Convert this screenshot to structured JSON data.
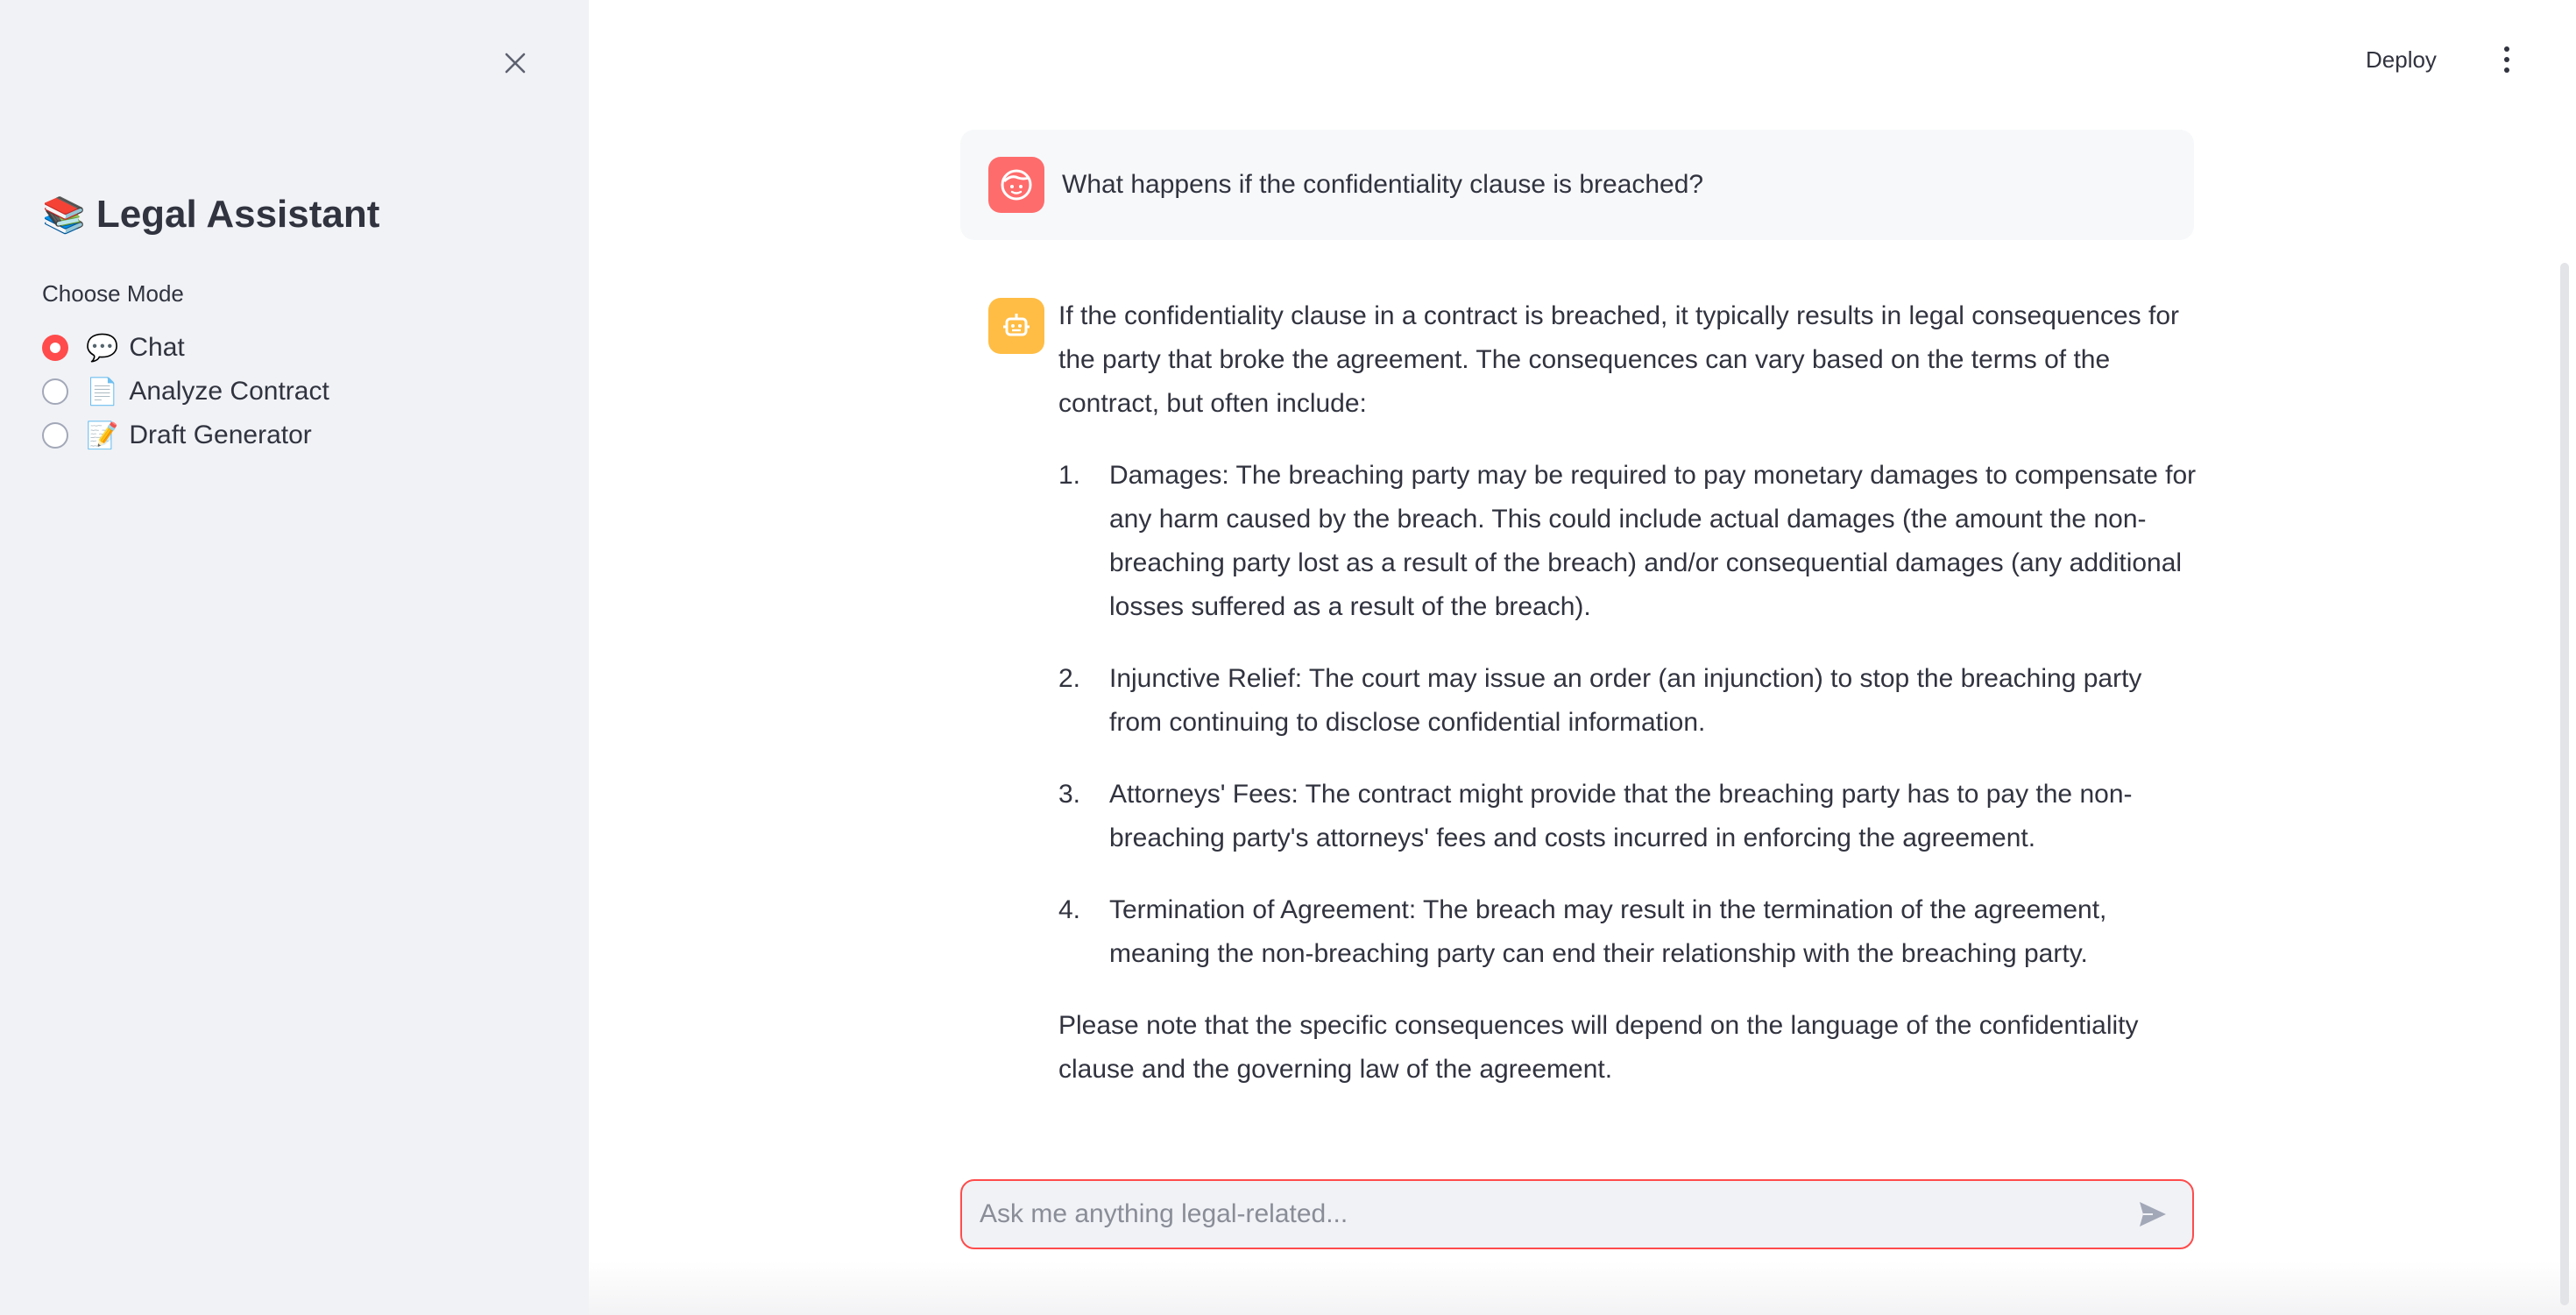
{
  "sidebar": {
    "title_emoji": "📚",
    "title": "Legal Assistant",
    "mode_label": "Choose Mode",
    "modes": [
      {
        "emoji": "💬",
        "label": "Chat",
        "selected": true
      },
      {
        "emoji": "📄",
        "label": "Analyze Contract",
        "selected": false
      },
      {
        "emoji": "📝",
        "label": "Draft Generator",
        "selected": false
      }
    ]
  },
  "header": {
    "deploy_label": "Deploy"
  },
  "chat": {
    "user_message": "What happens if the confidentiality clause is breached?",
    "bot_intro": "If the confidentiality clause in a contract is breached, it typically results in legal consequences for the party that broke the agreement. The consequences can vary based on the terms of the contract, but often include:",
    "bot_items": [
      {
        "num": "1.",
        "text": "Damages: The breaching party may be required to pay monetary damages to compensate for any harm caused by the breach. This could include actual damages (the amount the non-breaching party lost as a result of the breach) and/or consequential damages (any additional losses suffered as a result of the breach)."
      },
      {
        "num": "2.",
        "text": "Injunctive Relief: The court may issue an order (an injunction) to stop the breaching party from continuing to disclose confidential information."
      },
      {
        "num": "3.",
        "text": "Attorneys' Fees: The contract might provide that the breaching party has to pay the non-breaching party's attorneys' fees and costs incurred in enforcing the agreement."
      },
      {
        "num": "4.",
        "text": "Termination of Agreement: The breach may result in the termination of the agreement, meaning the non-breaching party can end their relationship with the breaching party."
      }
    ],
    "bot_outro": "Please note that the specific consequences will depend on the language of the confidentiality clause and the governing law of the agreement."
  },
  "input": {
    "placeholder": "Ask me anything legal-related...",
    "value": ""
  },
  "colors": {
    "accent": "#ff4b4b",
    "user_avatar": "#ff6c6c",
    "bot_avatar": "#ffbd45",
    "sidebar_bg": "#f0f2f6"
  },
  "icons": {
    "close": "close-icon",
    "menu": "vertical-dots-icon",
    "user": "user-face-icon",
    "bot": "robot-icon",
    "send": "send-icon"
  }
}
